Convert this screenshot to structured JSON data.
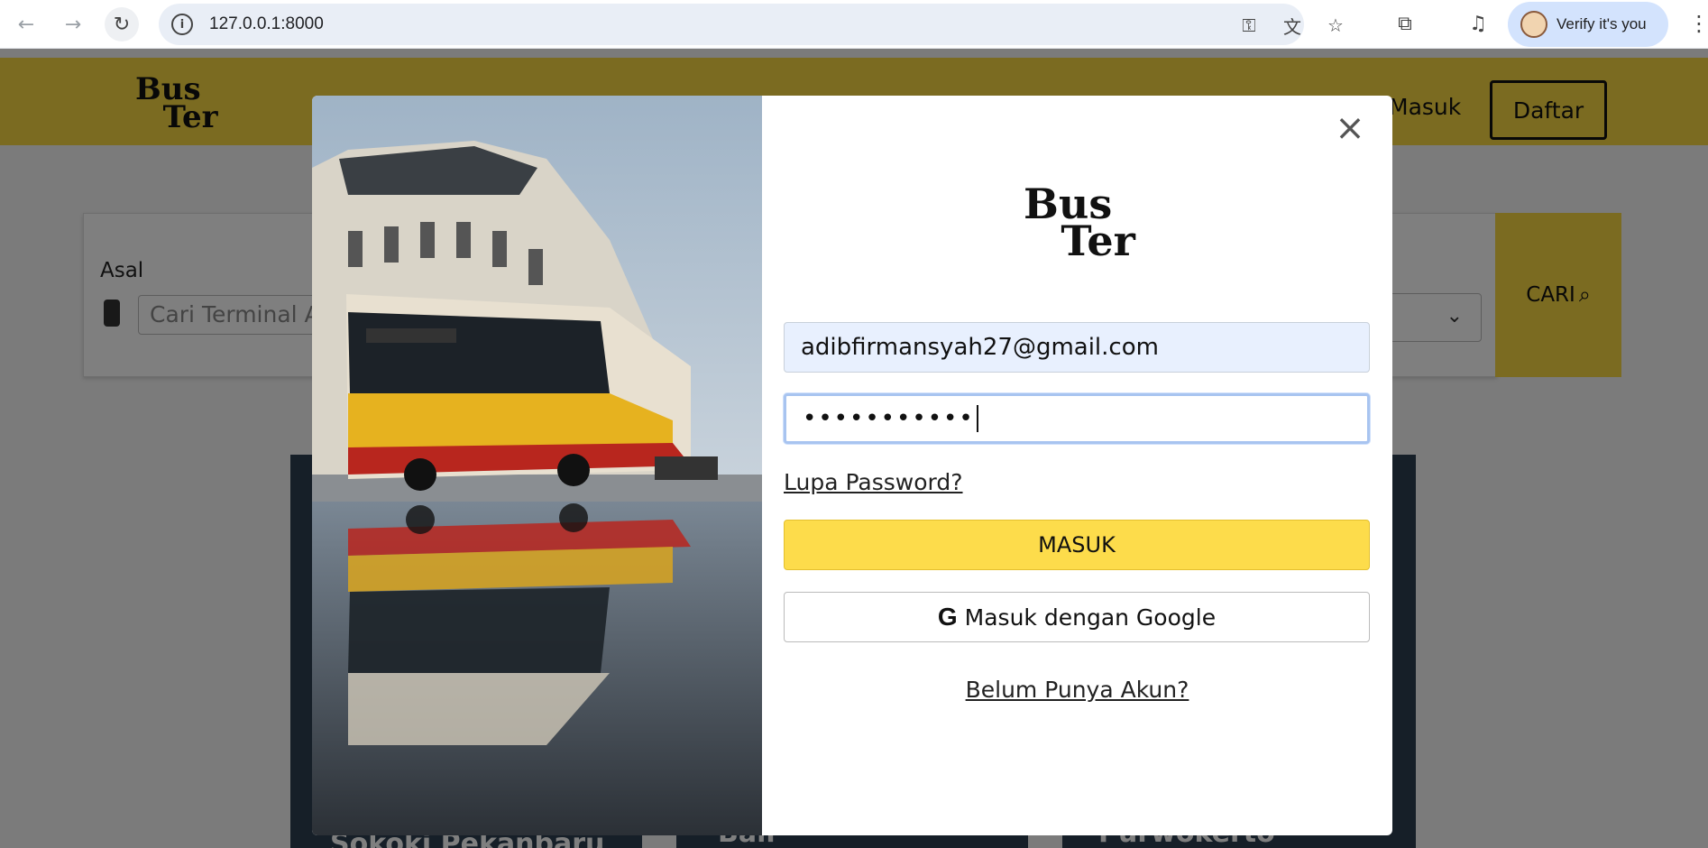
{
  "browser": {
    "url": "127.0.0.1:8000",
    "profile_button": "Verify it's you",
    "icons": [
      "back-icon",
      "forward-icon",
      "reload-icon",
      "site-info-icon",
      "key-icon",
      "translate-icon",
      "star-icon",
      "extensions-icon",
      "media-icon",
      "menu-icon"
    ]
  },
  "page": {
    "logo": {
      "line1": "Bus",
      "line2": "Ter"
    },
    "nav": {
      "masuk": "Masuk",
      "daftar": "Daftar"
    },
    "search": {
      "asal_label": "Asal",
      "asal_placeholder": "Cari Terminal A",
      "cari_label": "CARI"
    },
    "cards": [
      "Sokoki Pekanbaru",
      "Bali",
      "Purwokerto"
    ]
  },
  "modal": {
    "logo": {
      "line1": "Bus",
      "line2": "Ter"
    },
    "email_value": "adibfirmansyah27@gmail.com",
    "password_value": "•••••••••••",
    "forgot_link": "Lupa Password?",
    "login_button": "MASUK",
    "google_button": "Masuk dengan Google",
    "google_icon": "G",
    "register_link": "Belum Punya Akun?",
    "close_icon": "close-icon"
  },
  "colors": {
    "brand_yellow": "#f7d742",
    "button_yellow": "#fddc4b",
    "overlay": "rgba(0,0,0,0.5)"
  }
}
